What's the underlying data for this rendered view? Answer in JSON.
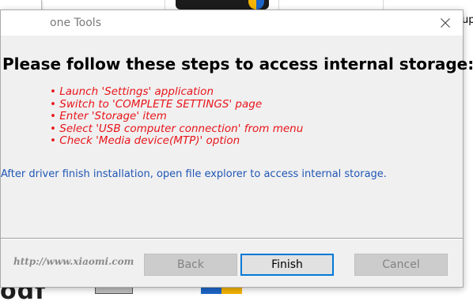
{
  "window": {
    "title": "one Tools"
  },
  "background": {
    "right_edge_text": "up",
    "bottom_text": "odf"
  },
  "instructions": {
    "heading": "Please follow these steps to access internal storage:",
    "steps": [
      "Launch 'Settings' application",
      "Switch to 'COMPLETE SETTINGS' page",
      "Enter 'Storage' item",
      "Select 'USB computer connection' from menu",
      "Check 'Media device(MTP)' option"
    ],
    "note": "After driver finish installation, open file explorer to access internal storage."
  },
  "footer": {
    "link": "http://www.xiaomi.com",
    "back_label": "Back",
    "finish_label": "Finish",
    "cancel_label": "Cancel"
  },
  "colors": {
    "steps": "#e8141a",
    "note": "#1f56b5",
    "default_button_border": "#0078d7"
  },
  "icons": {
    "close": "close-icon"
  }
}
